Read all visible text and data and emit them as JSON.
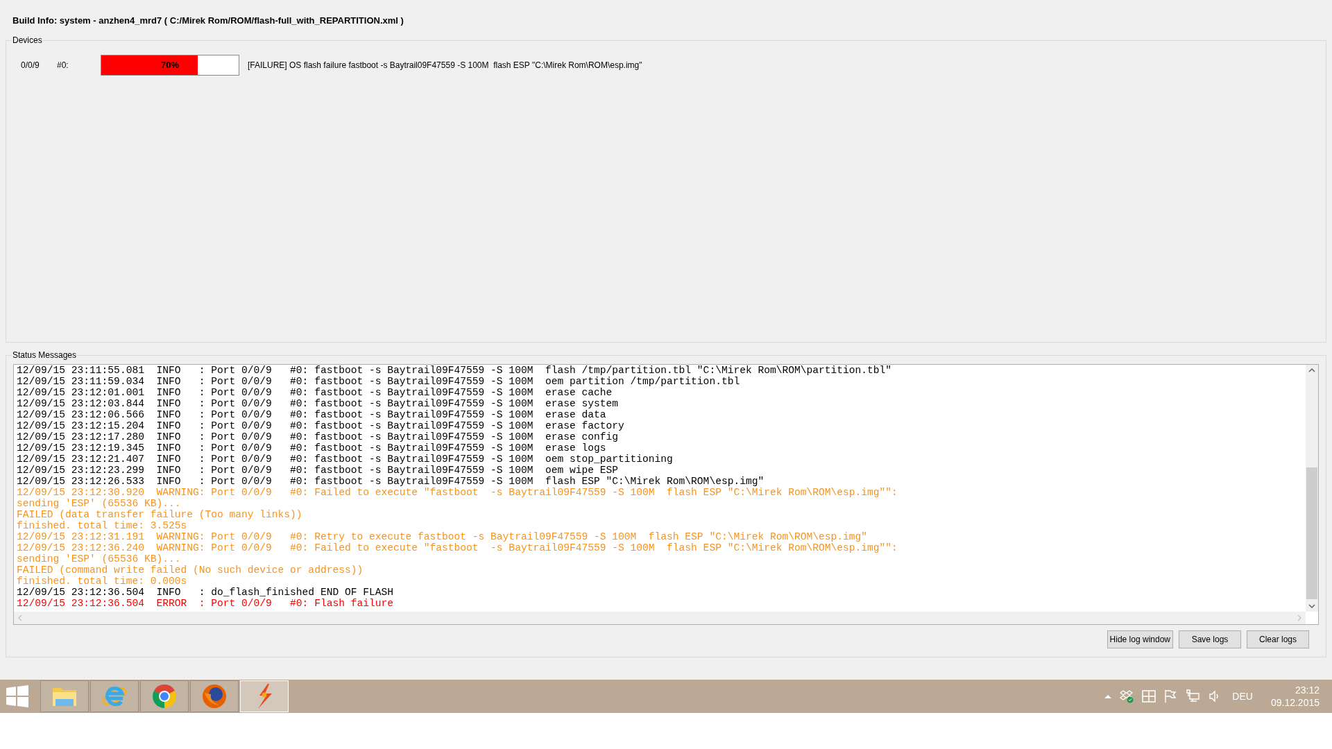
{
  "build_info": "Build Info: system - anzhen4_mrd7 ( C:/Mirek Rom/ROM/flash-full_with_REPARTITION.xml )",
  "devices": {
    "title": "Devices",
    "items": [
      {
        "port": "0/0/9",
        "index": "#0:",
        "level": 0.7,
        "percent": "70%",
        "status": "[FAILURE] OS flash failure fastboot -s Baytrail09F47559 -S 100M  flash ESP \"C:\\Mirek Rom\\ROM\\esp.img\""
      }
    ]
  },
  "status_messages": {
    "title": "Status Messages",
    "lines": [
      {
        "kind": "info",
        "text": "12/09/15 23:11:55.081  INFO   : Port 0/0/9   #0: fastboot -s Baytrail09F47559 -S 100M  flash /tmp/partition.tbl \"C:\\Mirek Rom\\ROM\\partition.tbl\""
      },
      {
        "kind": "info",
        "text": "12/09/15 23:11:59.034  INFO   : Port 0/0/9   #0: fastboot -s Baytrail09F47559 -S 100M  oem partition /tmp/partition.tbl"
      },
      {
        "kind": "info",
        "text": "12/09/15 23:12:01.001  INFO   : Port 0/0/9   #0: fastboot -s Baytrail09F47559 -S 100M  erase cache"
      },
      {
        "kind": "info",
        "text": "12/09/15 23:12:03.844  INFO   : Port 0/0/9   #0: fastboot -s Baytrail09F47559 -S 100M  erase system"
      },
      {
        "kind": "info",
        "text": "12/09/15 23:12:06.566  INFO   : Port 0/0/9   #0: fastboot -s Baytrail09F47559 -S 100M  erase data"
      },
      {
        "kind": "info",
        "text": "12/09/15 23:12:15.204  INFO   : Port 0/0/9   #0: fastboot -s Baytrail09F47559 -S 100M  erase factory"
      },
      {
        "kind": "info",
        "text": "12/09/15 23:12:17.280  INFO   : Port 0/0/9   #0: fastboot -s Baytrail09F47559 -S 100M  erase config"
      },
      {
        "kind": "info",
        "text": "12/09/15 23:12:19.345  INFO   : Port 0/0/9   #0: fastboot -s Baytrail09F47559 -S 100M  erase logs"
      },
      {
        "kind": "info",
        "text": "12/09/15 23:12:21.407  INFO   : Port 0/0/9   #0: fastboot -s Baytrail09F47559 -S 100M  oem stop_partitioning"
      },
      {
        "kind": "info",
        "text": "12/09/15 23:12:23.299  INFO   : Port 0/0/9   #0: fastboot -s Baytrail09F47559 -S 100M  oem wipe ESP"
      },
      {
        "kind": "info",
        "text": "12/09/15 23:12:26.533  INFO   : Port 0/0/9   #0: fastboot -s Baytrail09F47559 -S 100M  flash ESP \"C:\\Mirek Rom\\ROM\\esp.img\""
      },
      {
        "kind": "warning",
        "text": "12/09/15 23:12:30.920  WARNING: Port 0/0/9   #0: Failed to execute \"fastboot  -s Baytrail09F47559 -S 100M  flash ESP \"C:\\Mirek Rom\\ROM\\esp.img\"\":"
      },
      {
        "kind": "warning",
        "text": "sending 'ESP' (65536 KB)..."
      },
      {
        "kind": "warning",
        "text": "FAILED (data transfer failure (Too many links))"
      },
      {
        "kind": "warning",
        "text": "finished. total time: 3.525s"
      },
      {
        "kind": "warning",
        "text": "12/09/15 23:12:31.191  WARNING: Port 0/0/9   #0: Retry to execute fastboot -s Baytrail09F47559 -S 100M  flash ESP \"C:\\Mirek Rom\\ROM\\esp.img\""
      },
      {
        "kind": "warning",
        "text": "12/09/15 23:12:36.240  WARNING: Port 0/0/9   #0: Failed to execute \"fastboot  -s Baytrail09F47559 -S 100M  flash ESP \"C:\\Mirek Rom\\ROM\\esp.img\"\":"
      },
      {
        "kind": "warning",
        "text": "sending 'ESP' (65536 KB)..."
      },
      {
        "kind": "warning",
        "text": "FAILED (command write failed (No such device or address))"
      },
      {
        "kind": "warning",
        "text": "finished. total time: 0.000s"
      },
      {
        "kind": "info",
        "text": "12/09/15 23:12:36.504  INFO   : do_flash_finished END OF FLASH"
      },
      {
        "kind": "error",
        "text": "12/09/15 23:12:36.504  ERROR  : Port 0/0/9   #0: Flash failure"
      }
    ]
  },
  "buttons": [
    "Hide log window",
    "Save logs",
    "Clear logs"
  ],
  "taskbar": {
    "apps": [
      {
        "kind": "explorer",
        "selected": false
      },
      {
        "kind": "ie",
        "selected": false
      },
      {
        "kind": "chrome",
        "selected": false
      },
      {
        "kind": "firefox",
        "selected": false
      },
      {
        "kind": "flash",
        "selected": true
      }
    ],
    "language": "DEU",
    "time": "23:12",
    "date": "09.12.2015"
  }
}
